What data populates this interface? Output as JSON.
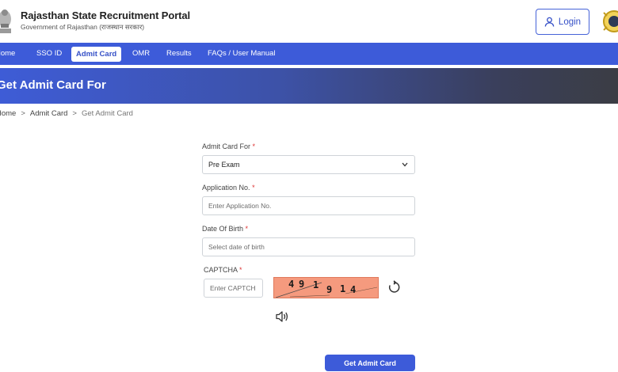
{
  "header": {
    "title": "Rajasthan State Recruitment Portal",
    "subtitle": "Government of Rajasthan (राजस्थान सरकार)",
    "login_label": "Login"
  },
  "nav": {
    "items": [
      {
        "label": "Home",
        "active": false
      },
      {
        "label": "SSO ID",
        "active": false
      },
      {
        "label": "Admit Card",
        "active": true
      },
      {
        "label": "OMR",
        "active": false
      },
      {
        "label": "Results",
        "active": false
      },
      {
        "label": "FAQs / User Manual",
        "active": false
      }
    ]
  },
  "banner": {
    "title": "Get Admit Card For"
  },
  "breadcrumb": {
    "items": [
      "Home",
      "Admit Card",
      "Get Admit Card"
    ],
    "separator": ">"
  },
  "form": {
    "admit_card_for": {
      "label": "Admit Card For",
      "required": "*",
      "value": "Pre Exam"
    },
    "application_no": {
      "label": "Application No.",
      "required": "*",
      "placeholder": "Enter Application No."
    },
    "dob": {
      "label": "Date Of Birth",
      "required": "*",
      "placeholder": "Select date of birth"
    },
    "captcha": {
      "label": "CAPTCHA",
      "required": "*",
      "placeholder": "Enter CAPTCH",
      "chars": [
        "4",
        "9",
        "1",
        "9",
        "1",
        "4"
      ]
    },
    "submit_label": "Get Admit Card"
  },
  "colors": {
    "primary": "#3d5bd9",
    "captcha_bg": "#f59a7e"
  },
  "icons": [
    "emblem-icon",
    "user-icon",
    "logo-icon",
    "chevron-down-icon",
    "refresh-icon",
    "speaker-icon"
  ]
}
